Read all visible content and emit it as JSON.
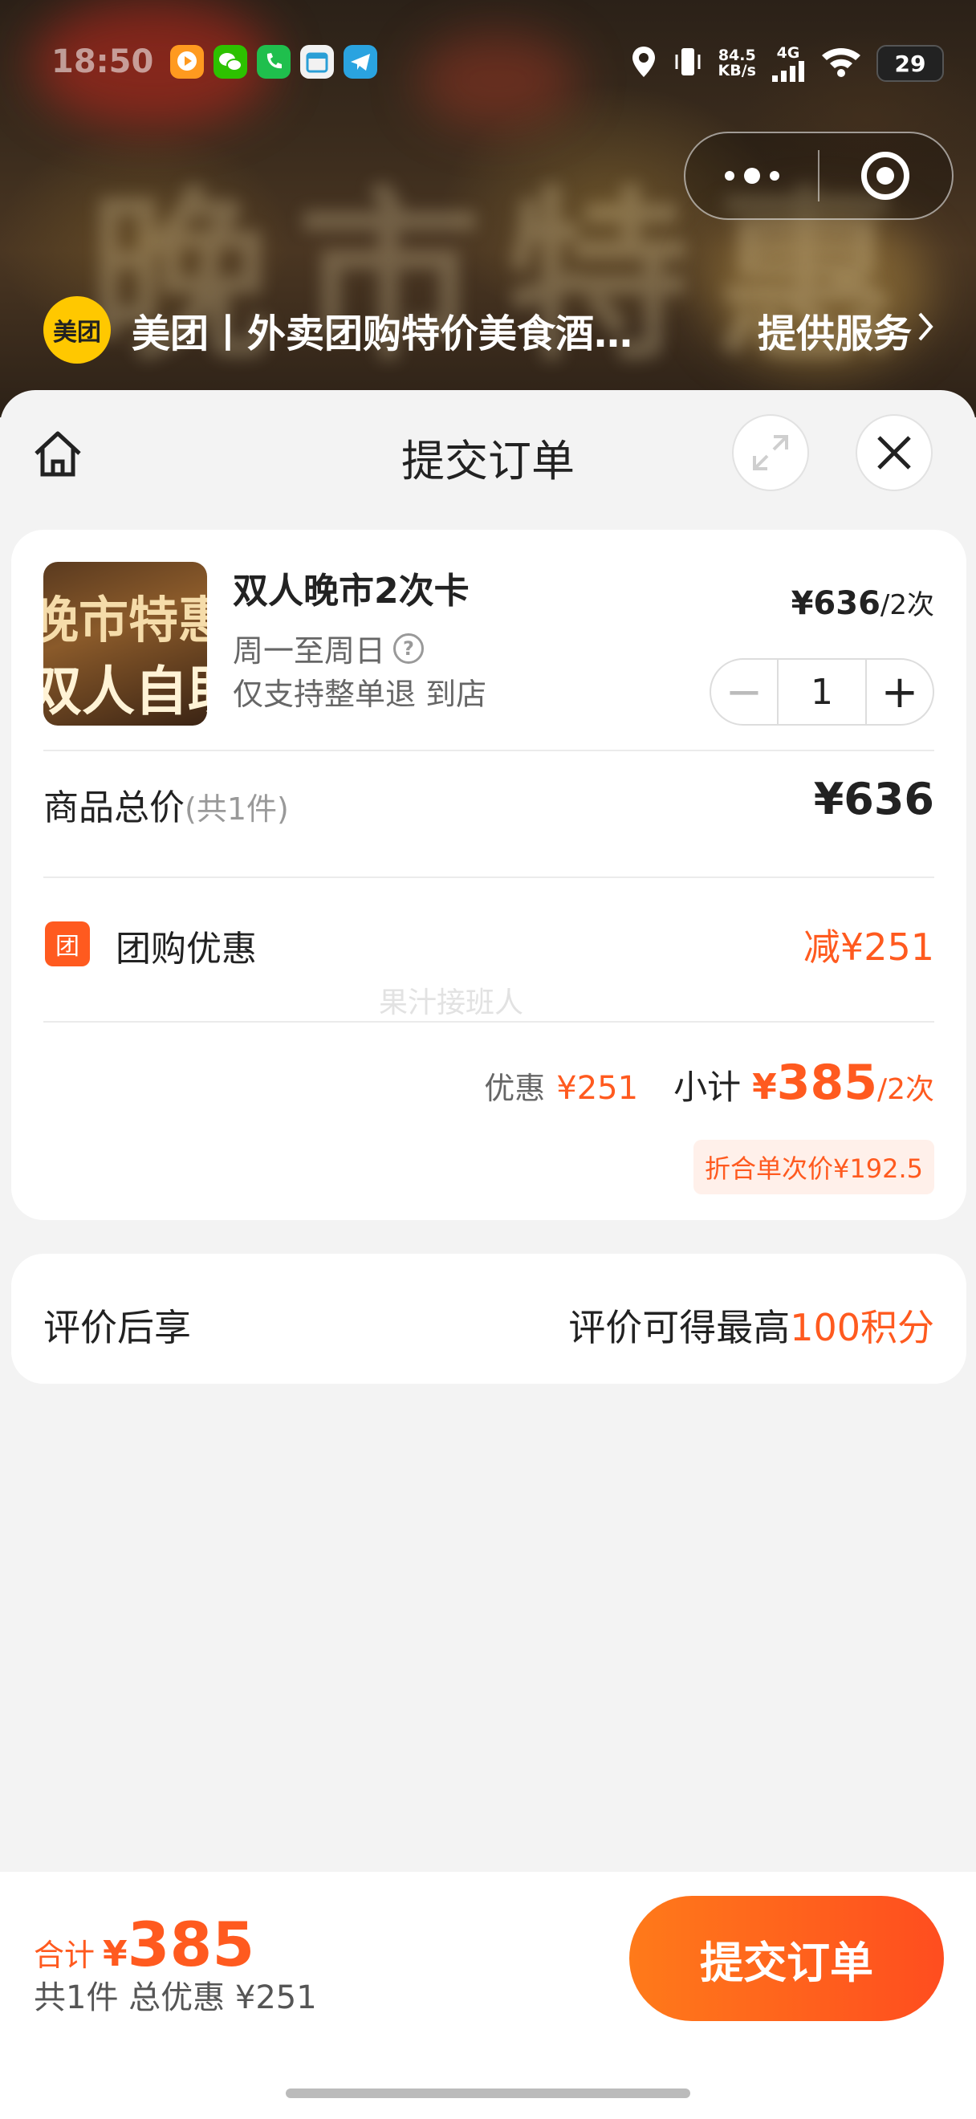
{
  "status_bar": {
    "time": "18:50",
    "net_speed_top": "84.5",
    "net_speed_unit": "KB/s",
    "network_type": "4G",
    "battery": "29",
    "apps": [
      {
        "name": "video-app-icon",
        "color": "#ff9a1f"
      },
      {
        "name": "wechat-icon",
        "color": "#2dc100"
      },
      {
        "name": "phone-app-icon",
        "color": "#1fbf4d"
      },
      {
        "name": "calendar-app-icon",
        "color": "#f2f2f2"
      },
      {
        "name": "telegram-icon",
        "color": "#2aa3e0"
      }
    ]
  },
  "mini_program": {
    "logo_text": "美团",
    "name": "美团丨外卖团购特价美食酒…",
    "provider": "提供服务"
  },
  "sheet": {
    "title": "提交订单"
  },
  "product": {
    "thumb_line1": "晚市特惠",
    "thumb_line2": "双人自助",
    "title": "双人晚市2次卡",
    "schedule": "周一至周日",
    "help_icon": "?",
    "refund_policy": "仅支持整单退 到店",
    "price": "¥636",
    "price_unit": "/2次",
    "quantity": "1",
    "minus": "−",
    "plus": "+"
  },
  "summary": {
    "total_label": "商品总价",
    "total_count": "(共1件)",
    "total_value": "¥636",
    "promo_icon": "团",
    "promo_label": "团购优惠",
    "promo_value": "减¥251",
    "watermark": "果汁接班人",
    "discount_label": "优惠",
    "discount_value": "¥251",
    "subtotal_label": "小计",
    "subtotal_currency": "¥",
    "subtotal_amount": "385",
    "subtotal_unit": "/2次",
    "per_use_price": "折合单次价¥192.5"
  },
  "review": {
    "label": "评价后享",
    "value_prefix": "评价可得最高",
    "value_highlight": "100积分"
  },
  "footer": {
    "total_label": "合计",
    "total_currency": "¥",
    "total_amount": "385",
    "total_sub": "共1件 总优惠 ¥251",
    "submit_label": "提交订单"
  },
  "colors": {
    "accent": "#ff5a1f",
    "meituan_yellow": "#ffc800"
  }
}
